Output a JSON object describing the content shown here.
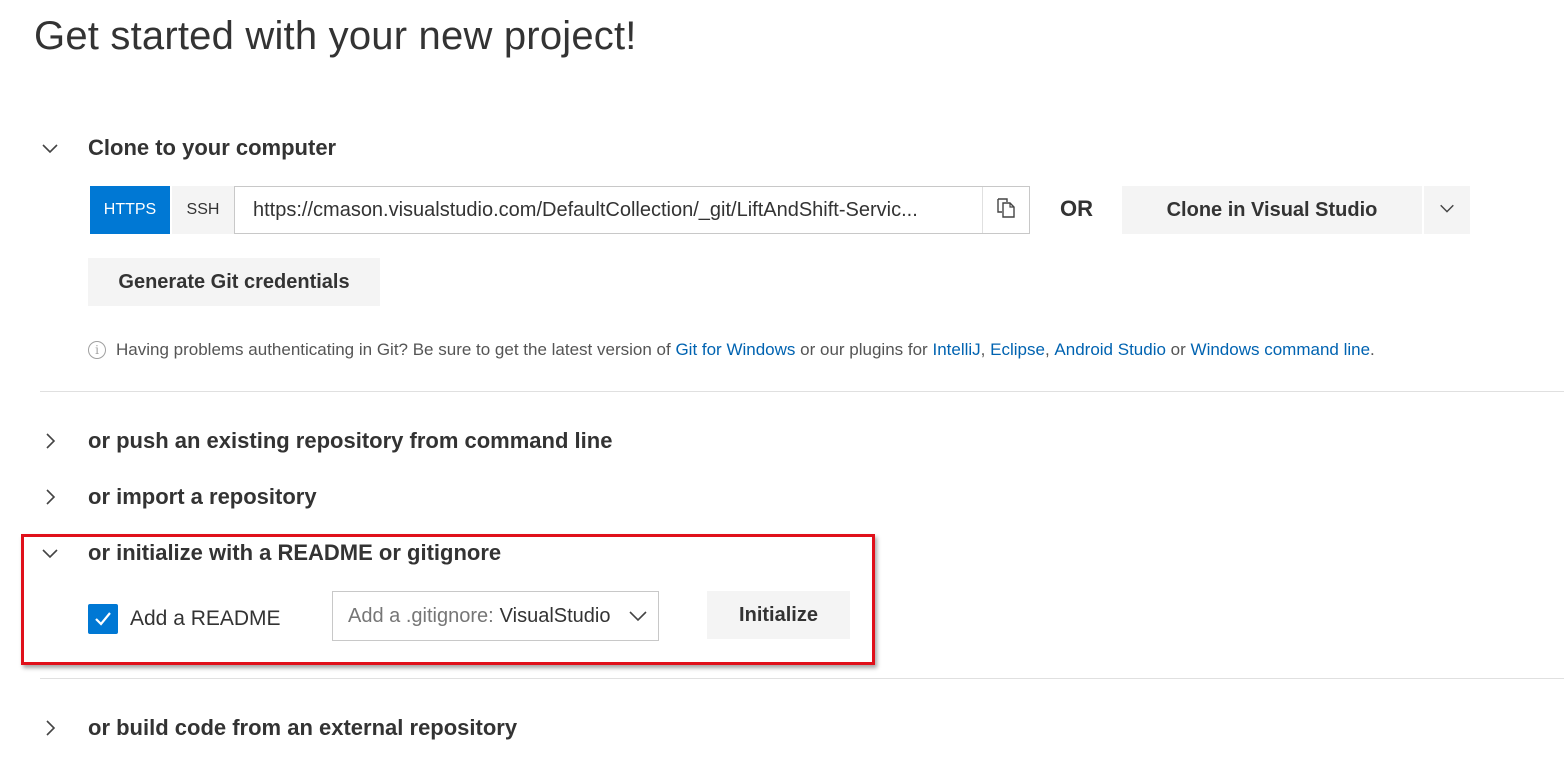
{
  "page": {
    "title": "Get started with your new project!"
  },
  "clone": {
    "section_title": "Clone to your computer",
    "protocols": {
      "https": "HTTPS",
      "ssh": "SSH"
    },
    "selected_protocol": "HTTPS",
    "url": "https://cmason.visualstudio.com/DefaultCollection/_git/LiftAndShift-Servic...",
    "or_label": "OR",
    "clone_vs_label": "Clone in Visual Studio",
    "generate_credentials_label": "Generate Git credentials",
    "help": {
      "text_1": "Having problems authenticating in Git? Be sure to get the latest version of",
      "link_git_windows": "Git for Windows",
      "text_2": "or our plugins for",
      "link_intellij": "IntelliJ",
      "sep_1": ",",
      "link_eclipse": "Eclipse",
      "sep_2": ",",
      "link_android": "Android Studio",
      "text_3": "or",
      "link_cmdline": "Windows command line",
      "text_end": "."
    }
  },
  "sections": {
    "push": "or push an existing repository from command line",
    "import": "or import a repository",
    "initialize": "or initialize with a README or gitignore",
    "build": "or build code from an external repository"
  },
  "initialize": {
    "readme_label": "Add a README",
    "readme_checked": true,
    "gitignore_prefix": "Add a .gitignore:",
    "gitignore_value": "VisualStudio",
    "initialize_label": "Initialize"
  },
  "colors": {
    "accent": "#0078d4",
    "link": "#0063b1",
    "highlight": "#e0101a",
    "button_bg": "#f4f4f4"
  }
}
